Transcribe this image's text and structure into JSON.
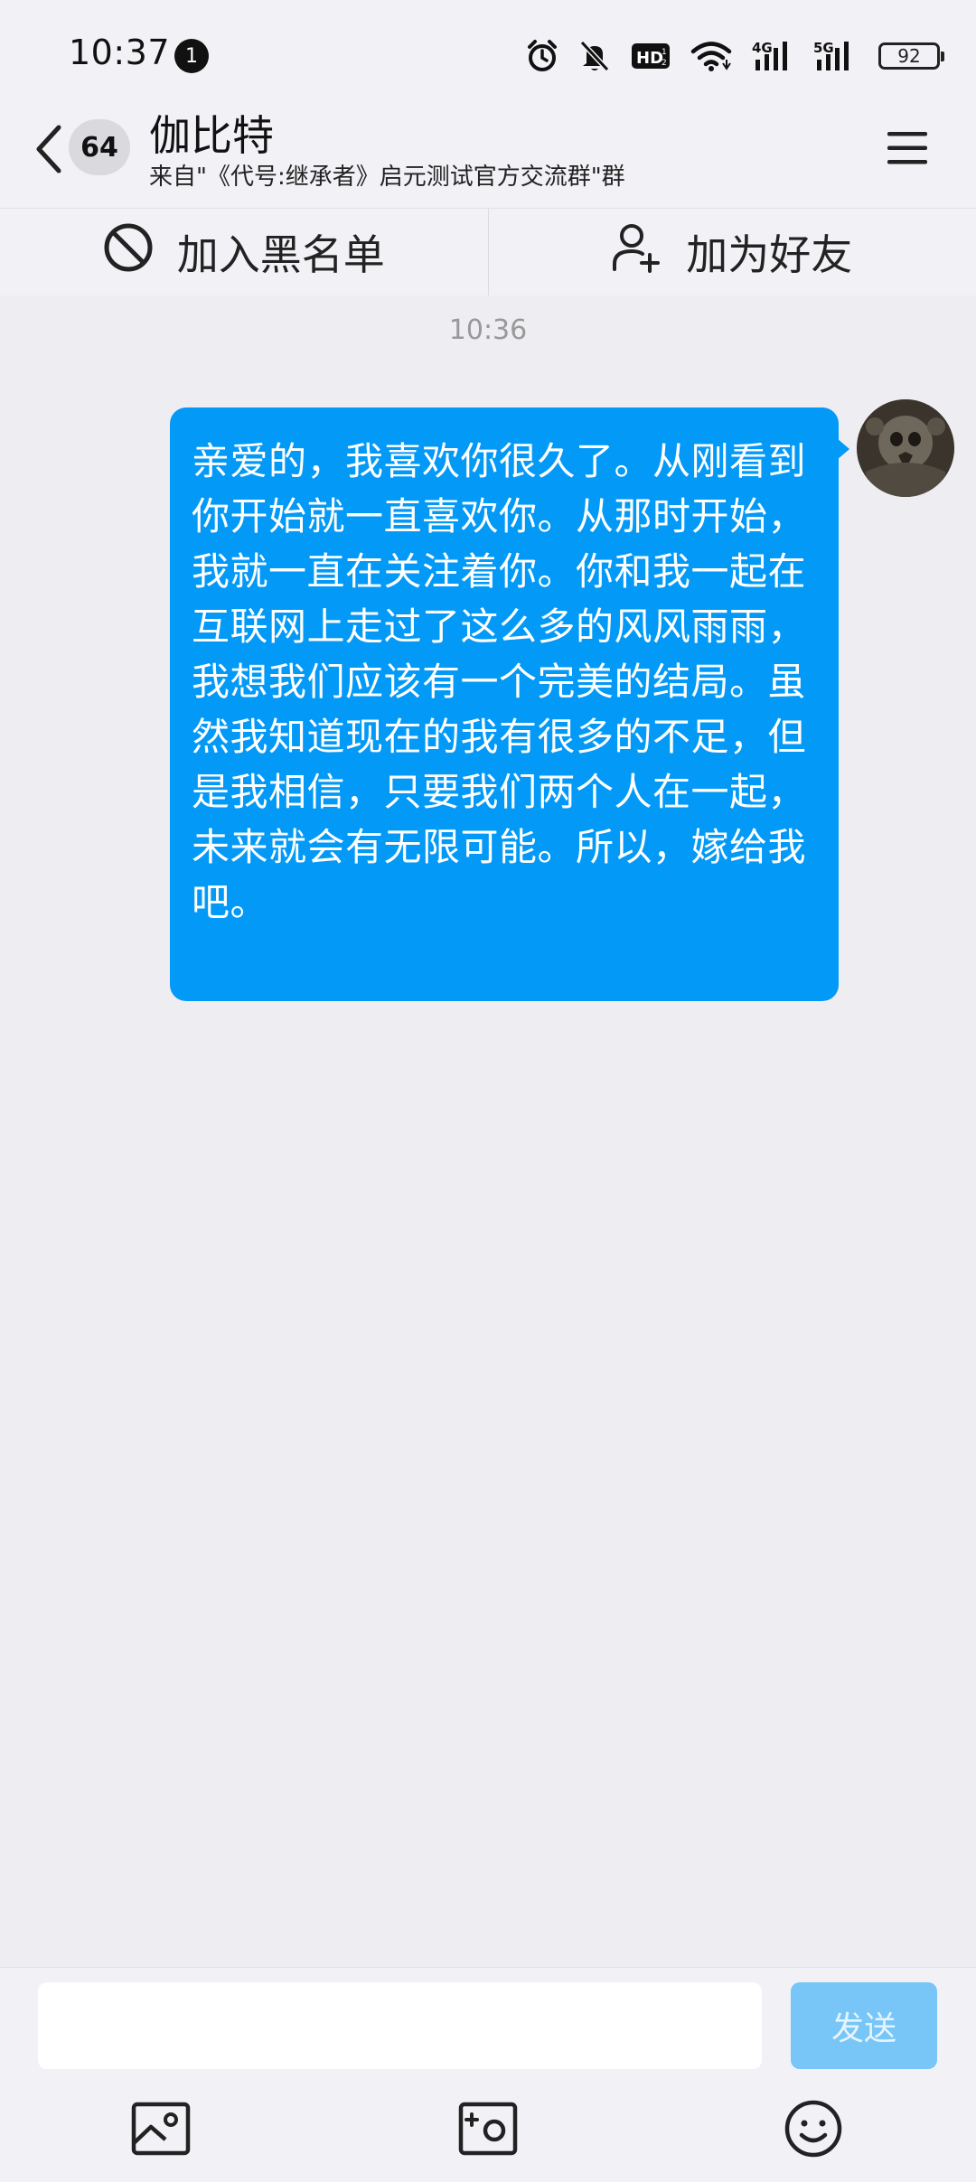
{
  "status_bar": {
    "time": "10:37",
    "notification_count": "1",
    "battery": "92",
    "icons": [
      "alarm-icon",
      "mute-icon",
      "hd-icon",
      "wifi-icon",
      "4g-signal-icon",
      "5g-signal-icon",
      "battery-icon"
    ]
  },
  "header": {
    "unread_count": "64",
    "title": "伽比特",
    "subtitle": "来自\"《代号:继承者》启元测试官方交流群\"群"
  },
  "actions": {
    "blacklist_label": "加入黑名单",
    "add_friend_label": "加为好友"
  },
  "chat": {
    "timestamp": "10:36",
    "messages": [
      {
        "sender": "self",
        "text": "亲爱的，我喜欢你很久了。从刚看到你开始就一直喜欢你。从那时开始，我就一直在关注着你。你和我一起在互联网上走过了这么多的风风雨雨，我想我们应该有一个完美的结局。虽然我知道现在的我有很多的不足，但是我相信，只要我们两个人在一起，未来就会有无限可能。所以，嫁给我吧。"
      }
    ]
  },
  "input": {
    "value": "",
    "placeholder": "",
    "send_label": "发送"
  },
  "toolbar": {
    "icons": [
      "image-icon",
      "camera-icon",
      "emoji-icon"
    ]
  },
  "colors": {
    "bubble": "#0399f7",
    "send_button_disabled": "#77c6f7",
    "background": "#ededf2"
  }
}
